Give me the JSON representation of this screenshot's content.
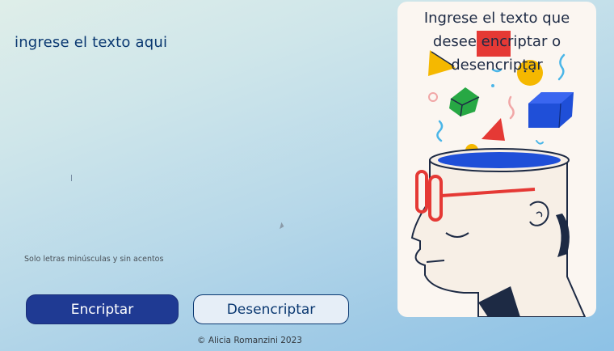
{
  "input": {
    "placeholder": "ingrese el texto aqui"
  },
  "hint": {
    "text": "Solo letras minúsculas y sin acentos"
  },
  "buttons": {
    "encrypt_label": "Encriptar",
    "decrypt_label": "Desencriptar"
  },
  "card": {
    "title": "Ingrese el texto que desee encriptar o desencriptar",
    "illustration_icon": "head-with-shapes-illustration"
  },
  "footer": {
    "text": "© Alicia Romanzini 2023"
  },
  "colors": {
    "primary": "#1f3a93",
    "text_dark": "#0a3871",
    "card_bg": "#fbf6f1"
  }
}
